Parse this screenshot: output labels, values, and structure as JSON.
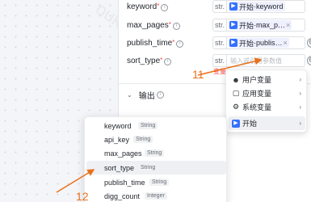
{
  "params": [
    {
      "name": "keyword",
      "required": true,
      "type": "str.",
      "value_prefix": "开始",
      "value_sep": "·",
      "value_var": "keyword",
      "kind": "tag"
    },
    {
      "name": "max_pages",
      "required": true,
      "type": "str.",
      "value_prefix": "开始",
      "value_sep": "·",
      "value_var": "max_p…",
      "kind": "tag"
    },
    {
      "name": "publish_time",
      "required": true,
      "type": "str.",
      "value_prefix": "开始",
      "value_sep": "·",
      "value_var": "publis…",
      "kind": "tag"
    },
    {
      "name": "sort_type",
      "required": true,
      "type": "str.",
      "placeholder": "输入或引用参数值",
      "kind": "input"
    }
  ],
  "warning_text": "变量",
  "output_label": "输出",
  "menu": {
    "items": [
      {
        "label": "用户变量",
        "icon": "user-icon"
      },
      {
        "label": "应用变量",
        "icon": "folder-icon"
      },
      {
        "label": "系统变量",
        "icon": "gear-icon"
      },
      {
        "label": "开始",
        "icon": "start-node-icon"
      }
    ]
  },
  "variables": [
    {
      "name": "keyword",
      "type": "String"
    },
    {
      "name": "api_key",
      "type": "String"
    },
    {
      "name": "max_pages",
      "type": "String"
    },
    {
      "name": "sort_type",
      "type": "String"
    },
    {
      "name": "publish_time",
      "type": "String"
    },
    {
      "name": "digg_count",
      "type": "Integer"
    }
  ],
  "annotations": {
    "step1": "11",
    "step2": "12"
  },
  "colors": {
    "accent": "#3370ff",
    "annotation": "#e8711c",
    "required": "#f54a45"
  }
}
